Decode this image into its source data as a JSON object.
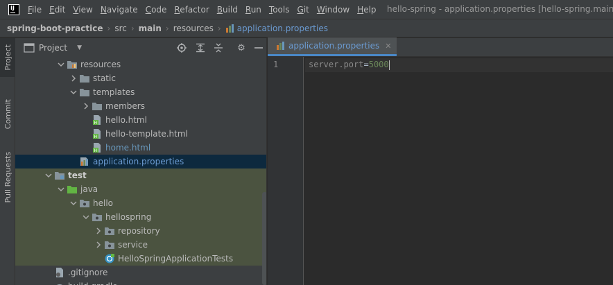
{
  "menubar": {
    "logo": "IJ",
    "items": [
      "File",
      "Edit",
      "View",
      "Navigate",
      "Code",
      "Refactor",
      "Build",
      "Run",
      "Tools",
      "Git",
      "Window",
      "Help"
    ],
    "window_title": "hello-spring - application.properties [hello-spring.main]"
  },
  "breadcrumb": {
    "project": "spring-boot-practice",
    "src": "src",
    "main": "main",
    "resources": "resources",
    "file": "application.properties"
  },
  "stripe": {
    "project": "Project",
    "commit": "Commit",
    "pull_requests": "Pull Requests"
  },
  "panel": {
    "title": "Project",
    "icons": [
      "locate-icon",
      "expand-all-icon",
      "collapse-all-icon",
      "gear-icon",
      "minimize-icon"
    ]
  },
  "tree": [
    {
      "label": "resources",
      "icon": "resources-folder",
      "indent": 1,
      "expanded": true
    },
    {
      "label": "static",
      "icon": "folder",
      "indent": 2,
      "expanded": false
    },
    {
      "label": "templates",
      "icon": "folder",
      "indent": 2,
      "expanded": true
    },
    {
      "label": "members",
      "icon": "folder",
      "indent": 3,
      "expanded": false
    },
    {
      "label": "hello.html",
      "icon": "html-file",
      "indent": 3
    },
    {
      "label": "hello-template.html",
      "icon": "html-file",
      "indent": 3
    },
    {
      "label": "home.html",
      "icon": "html-file",
      "indent": 3
    },
    {
      "label": "application.properties",
      "icon": "properties-file",
      "indent": 2,
      "selected": true
    },
    {
      "label": "test",
      "icon": "test-folder",
      "indent": 0,
      "expanded": true
    },
    {
      "label": "java",
      "icon": "test-source-folder",
      "indent": 1,
      "expanded": true
    },
    {
      "label": "hello",
      "icon": "package",
      "indent": 2,
      "expanded": true
    },
    {
      "label": "hellospring",
      "icon": "package",
      "indent": 3,
      "expanded": true
    },
    {
      "label": "repository",
      "icon": "package",
      "indent": 4,
      "expanded": false
    },
    {
      "label": "service",
      "icon": "package",
      "indent": 4,
      "expanded": false
    },
    {
      "label": "HelloSpringApplicationTests",
      "icon": "test-class",
      "indent": 4
    },
    {
      "label": ".gitignore",
      "icon": "gitignore-file",
      "indent": 0
    },
    {
      "label": "build.gradle",
      "icon": "gradle-file",
      "indent": 0
    }
  ],
  "editor": {
    "tab_label": "application.properties",
    "line_number": "1",
    "code_key": "server.port",
    "code_eq": "=",
    "code_value": "5000"
  },
  "colors": {
    "background": "#2b2b2b",
    "panel": "#3c3f41",
    "selection": "#0d293e",
    "test_highlight": "#4b5340",
    "link_blue": "#6b9bd2",
    "value_green": "#6a8759"
  }
}
